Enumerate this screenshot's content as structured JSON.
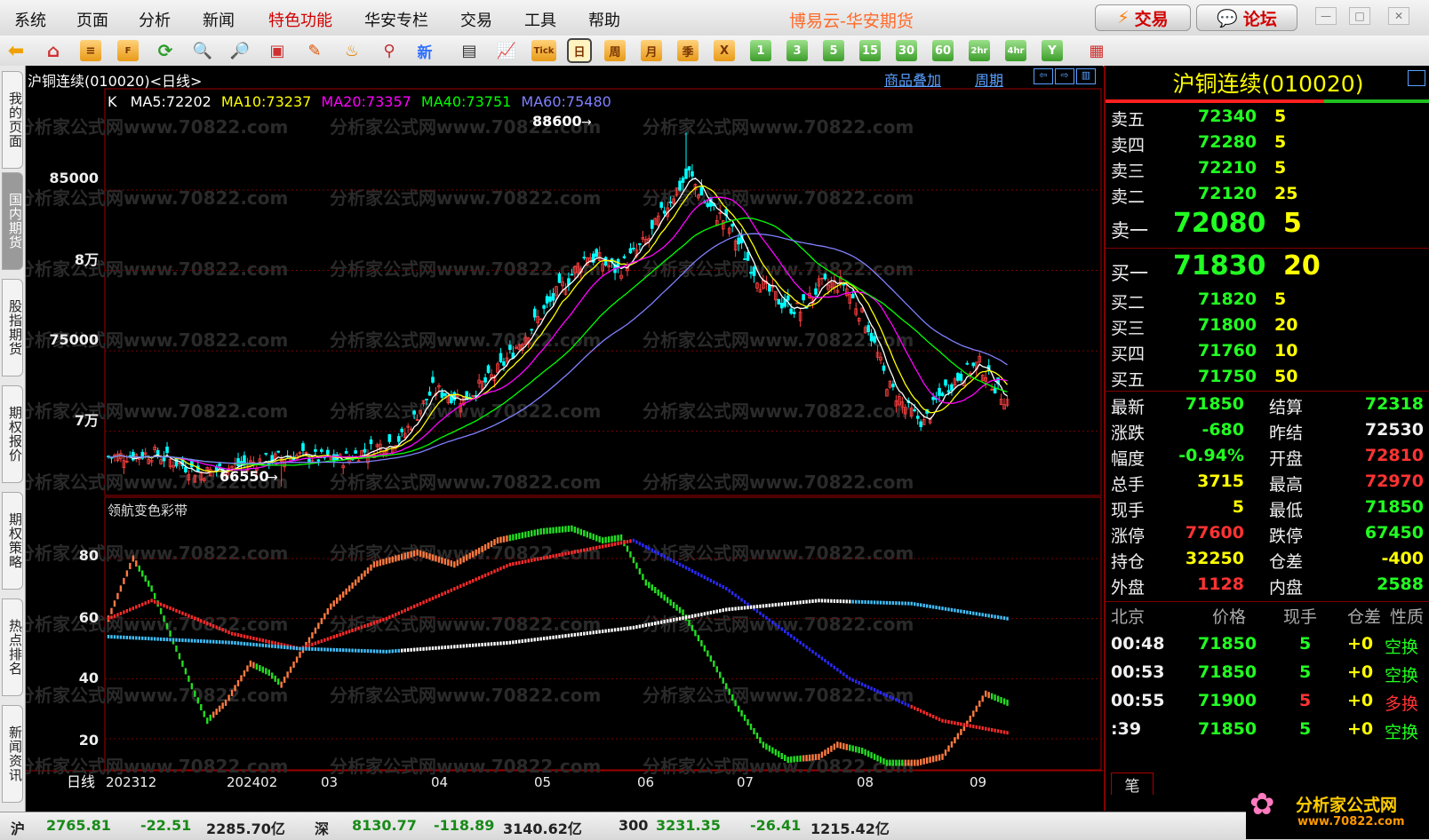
{
  "menu": {
    "items": [
      "系统",
      "页面",
      "分析",
      "新闻",
      "特色功能",
      "华安专栏",
      "交易",
      "工具",
      "帮助"
    ],
    "app_title": "博易云-华安期货",
    "trade_button": "交易",
    "forum_button": "论坛"
  },
  "toolbar": {
    "new_label": "新",
    "tick_label": "Tick",
    "periods": [
      "日",
      "周",
      "月",
      "季",
      "X",
      "1",
      "3",
      "5",
      "15",
      "30",
      "60",
      "2hr",
      "4hr",
      "Y"
    ]
  },
  "left_tabs": [
    "我的页面",
    "国内期货",
    "股指期货",
    "期权报价",
    "期权策略",
    "热点排名",
    "新闻资讯"
  ],
  "chart": {
    "title": "沪铜连续(010020)<日线>",
    "overlay_link": "商品叠加",
    "period_link": "周期",
    "ma_legend": {
      "k": "K",
      "ma5": "MA5:72202",
      "ma10": "MA10:73237",
      "ma20": "MA20:73357",
      "ma40": "MA40:73751",
      "ma60": "MA60:75480"
    },
    "indicator_name": "领航变色彩带",
    "price_labels": [
      "85000",
      "8万",
      "75000",
      "7万"
    ],
    "indicator_labels": [
      "80",
      "60",
      "40",
      "20"
    ],
    "high_annotation": "88600",
    "low_annotation": "66550",
    "x_axis_name": "日线",
    "x_labels": [
      "202312",
      "202402",
      "03",
      "04",
      "05",
      "06",
      "07",
      "08",
      "09"
    ],
    "watermark": "分析家公式网www.70822.com",
    "colors": {
      "up": "#ff4040",
      "down": "#00ffff",
      "ma5": "#ffffff",
      "ma10": "#ffff00",
      "ma20": "#ff00ff",
      "ma40": "#00ff00",
      "ma60": "#8080ff"
    }
  },
  "chart_data": {
    "type": "candlestick",
    "symbol": "沪铜连续(010020)",
    "price_ticks": [
      70000,
      75000,
      80000,
      85000
    ],
    "high": 88600,
    "low": 66550,
    "ma": {
      "MA5": 72202,
      "MA10": 73237,
      "MA20": 73357,
      "MA40": 73751,
      "MA60": 75480
    },
    "indicator": {
      "name": "领航变色彩带",
      "ticks": [
        20,
        40,
        60,
        80
      ]
    },
    "x": [
      "202312",
      "202402",
      "03",
      "04",
      "05",
      "06",
      "07",
      "08",
      "09"
    ]
  },
  "quote": {
    "title": "沪铜连续(010020)",
    "sell": [
      {
        "label": "卖五",
        "price": "72340",
        "vol": "5"
      },
      {
        "label": "卖四",
        "price": "72280",
        "vol": "5"
      },
      {
        "label": "卖三",
        "price": "72210",
        "vol": "5"
      },
      {
        "label": "卖二",
        "price": "72120",
        "vol": "25"
      },
      {
        "label": "卖一",
        "price": "72080",
        "vol": "5"
      }
    ],
    "buy": [
      {
        "label": "买一",
        "price": "71830",
        "vol": "20"
      },
      {
        "label": "买二",
        "price": "71820",
        "vol": "5"
      },
      {
        "label": "买三",
        "price": "71800",
        "vol": "20"
      },
      {
        "label": "买四",
        "price": "71760",
        "vol": "10"
      },
      {
        "label": "买五",
        "price": "71750",
        "vol": "50"
      }
    ],
    "stats": [
      {
        "l1": "最新",
        "v1": "71850",
        "c1": "green",
        "l2": "结算",
        "v2": "72318",
        "c2": "green"
      },
      {
        "l1": "涨跌",
        "v1": "-680",
        "c1": "green",
        "l2": "昨结",
        "v2": "72530",
        "c2": "white"
      },
      {
        "l1": "幅度",
        "v1": "-0.94%",
        "c1": "green",
        "l2": "开盘",
        "v2": "72810",
        "c2": "red"
      },
      {
        "l1": "总手",
        "v1": "3715",
        "c1": "yellow",
        "l2": "最高",
        "v2": "72970",
        "c2": "red"
      },
      {
        "l1": "现手",
        "v1": "5",
        "c1": "yellow",
        "l2": "最低",
        "v2": "71850",
        "c2": "green"
      },
      {
        "l1": "涨停",
        "v1": "77600",
        "c1": "red",
        "l2": "跌停",
        "v2": "67450",
        "c2": "green"
      },
      {
        "l1": "持仓",
        "v1": "32250",
        "c1": "yellow",
        "l2": "仓差",
        "v2": "-400",
        "c2": "yellow"
      },
      {
        "l1": "外盘",
        "v1": "1128",
        "c1": "red",
        "l2": "内盘",
        "v2": "2588",
        "c2": "green"
      }
    ],
    "ticks_header": [
      "北京",
      "价格",
      "现手",
      "仓差",
      "性质"
    ],
    "ticks": [
      {
        "time": "00:48",
        "price": "71850",
        "vol": "5",
        "oi": "+0",
        "type": "空换",
        "vc": "green",
        "tc": "green"
      },
      {
        "time": "00:53",
        "price": "71850",
        "vol": "5",
        "oi": "+0",
        "type": "空换",
        "vc": "green",
        "tc": "green"
      },
      {
        "time": "00:55",
        "price": "71900",
        "vol": "5",
        "oi": "+0",
        "type": "多换",
        "vc": "red",
        "tc": "red"
      },
      {
        "time": ":39",
        "price": "71850",
        "vol": "5",
        "oi": "+0",
        "type": "空换",
        "vc": "green",
        "tc": "green"
      }
    ],
    "tab": "笔"
  },
  "status": {
    "sh_label": "沪",
    "sh_val": "2765.81",
    "sh_chg": "-22.51",
    "sh_amt": "2285.70亿",
    "sz_label": "深",
    "sz_val": "8130.77",
    "sz_chg": "-118.89",
    "sz_amt": "3140.62亿",
    "i300_label": "300",
    "i300_val": "3231.35",
    "i300_chg": "-26.41",
    "i300_amt": "1215.42亿",
    "logo_text": "分析家公式网",
    "logo_url": "www.70822.com"
  }
}
